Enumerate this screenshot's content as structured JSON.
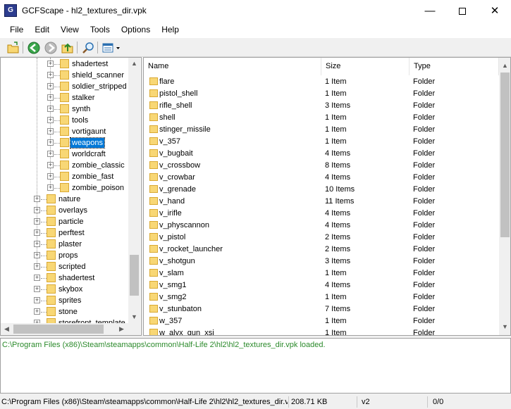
{
  "window": {
    "title": "GCFScape - hl2_textures_dir.vpk",
    "minimize": "—",
    "close": "✕"
  },
  "menu": [
    "File",
    "Edit",
    "View",
    "Tools",
    "Options",
    "Help"
  ],
  "toolbar": {
    "icons": [
      "open-folder-icon",
      "back-icon",
      "forward-icon",
      "up-folder-icon",
      "search-icon",
      "view-mode-icon"
    ]
  },
  "tree": {
    "subitems": [
      "shadertest",
      "shield_scanner",
      "soldier_stripped",
      "stalker",
      "synth",
      "tools",
      "vortigaunt",
      "weapons",
      "worldcraft",
      "zombie_classic",
      "zombie_fast",
      "zombie_poison"
    ],
    "selected": "weapons",
    "items": [
      "nature",
      "overlays",
      "particle",
      "perftest",
      "plaster",
      "props",
      "scripted",
      "shadertest",
      "skybox",
      "sprites",
      "stone",
      "storefront_template"
    ]
  },
  "list": {
    "columns": [
      "Name",
      "Size",
      "Type"
    ],
    "rows": [
      {
        "name": "flare",
        "size": "1 Item",
        "type": "Folder"
      },
      {
        "name": "pistol_shell",
        "size": "1 Item",
        "type": "Folder"
      },
      {
        "name": "rifle_shell",
        "size": "3 Items",
        "type": "Folder"
      },
      {
        "name": "shell",
        "size": "1 Item",
        "type": "Folder"
      },
      {
        "name": "stinger_missile",
        "size": "1 Item",
        "type": "Folder"
      },
      {
        "name": "v_357",
        "size": "1 Item",
        "type": "Folder"
      },
      {
        "name": "v_bugbait",
        "size": "4 Items",
        "type": "Folder"
      },
      {
        "name": "v_crossbow",
        "size": "8 Items",
        "type": "Folder"
      },
      {
        "name": "v_crowbar",
        "size": "4 Items",
        "type": "Folder"
      },
      {
        "name": "v_grenade",
        "size": "10 Items",
        "type": "Folder"
      },
      {
        "name": "v_hand",
        "size": "11 Items",
        "type": "Folder"
      },
      {
        "name": "v_irifle",
        "size": "4 Items",
        "type": "Folder"
      },
      {
        "name": "v_physcannon",
        "size": "4 Items",
        "type": "Folder"
      },
      {
        "name": "v_pistol",
        "size": "2 Items",
        "type": "Folder"
      },
      {
        "name": "v_rocket_launcher",
        "size": "2 Items",
        "type": "Folder"
      },
      {
        "name": "v_shotgun",
        "size": "3 Items",
        "type": "Folder"
      },
      {
        "name": "v_slam",
        "size": "1 Item",
        "type": "Folder"
      },
      {
        "name": "v_smg1",
        "size": "4 Items",
        "type": "Folder"
      },
      {
        "name": "v_smg2",
        "size": "1 Item",
        "type": "Folder"
      },
      {
        "name": "v_stunbaton",
        "size": "7 Items",
        "type": "Folder"
      },
      {
        "name": "w_357",
        "size": "1 Item",
        "type": "Folder"
      },
      {
        "name": "w_alyx_gun_xsi",
        "size": "1 Item",
        "type": "Folder"
      }
    ]
  },
  "log": {
    "line": "C:\\Program Files (x86)\\Steam\\steamapps\\common\\Half-Life 2\\hl2\\hl2_textures_dir.vpk loaded."
  },
  "status": {
    "path": "C:\\Program Files (x86)\\Steam\\steamapps\\common\\Half-Life 2\\hl2\\hl2_textures_dir.vpk",
    "size": "208.71 KB",
    "version": "v2",
    "count": "0/0"
  },
  "colors": {
    "selection": "#0078d7",
    "log_text": "#2b8a2b",
    "folder": "#f8d775"
  }
}
